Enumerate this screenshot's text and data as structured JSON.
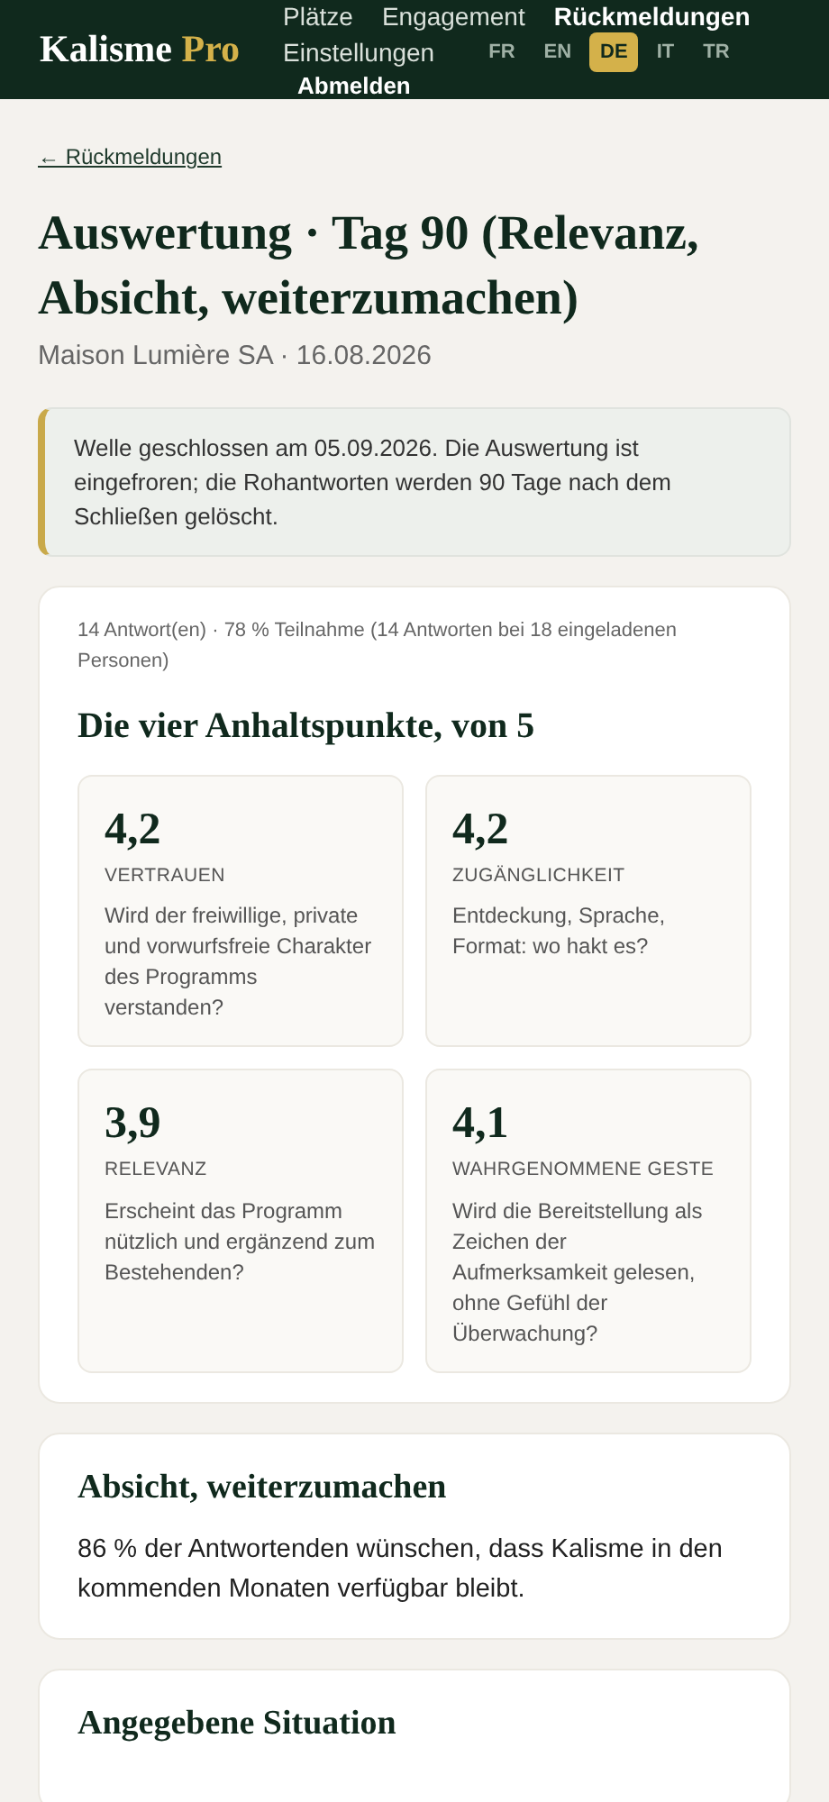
{
  "header": {
    "logo": {
      "name": "Kalisme",
      "suffix": "Pro"
    },
    "nav": [
      {
        "label": "Plätze",
        "selected": false
      },
      {
        "label": "Engagement",
        "selected": false
      },
      {
        "label": "Rückmeldungen",
        "selected": true
      },
      {
        "label": "Einstellungen",
        "selected": false
      }
    ],
    "languages": [
      {
        "label": "FR",
        "selected": false
      },
      {
        "label": "EN",
        "selected": false
      },
      {
        "label": "DE",
        "selected": true
      },
      {
        "label": "IT",
        "selected": false
      },
      {
        "label": "TR",
        "selected": false
      }
    ],
    "logout": "Abmelden"
  },
  "back_link": "← Rückmeldungen",
  "title": "Auswertung · Tag 90 (Relevanz, Absicht, weiterzumachen)",
  "subtitle": "Maison Lumière SA · 16.08.2026",
  "notice": "Welle geschlossen am 05.09.2026. Die Auswertung ist eingefroren; die Rohantworten werden 90 Tage nach dem Schließen gelöscht.",
  "summary": {
    "participation": "14 Antwort(en) · 78 % Teilnahme (14 Antworten bei 18 eingeladenen Personen)",
    "heading": "Die vier Anhaltspunkte, von 5",
    "indicators": [
      {
        "score": "4,2",
        "label": "VERTRAUEN",
        "question": "Wird der freiwillige, private und vorwurfsfreie Charakter des Programms verstanden?"
      },
      {
        "score": "4,2",
        "label": "ZUGÄNGLICHKEIT",
        "question": "Entdeckung, Sprache, Format: wo hakt es?"
      },
      {
        "score": "3,9",
        "label": "RELEVANZ",
        "question": "Erscheint das Programm nützlich und ergänzend zum Bestehenden?"
      },
      {
        "score": "4,1",
        "label": "WAHRGENOMMENE GESTE",
        "question": "Wird die Bereitstellung als Zeichen der Aufmerksamkeit gelesen, ohne Gefühl der Überwachung?"
      }
    ]
  },
  "intent": {
    "heading": "Absicht, weiterzumachen",
    "text": "86 % der Antwortenden wünschen, dass Kalisme in den kommenden Monaten verfügbar bleibt."
  },
  "situation": {
    "heading": "Angegebene Situation"
  }
}
